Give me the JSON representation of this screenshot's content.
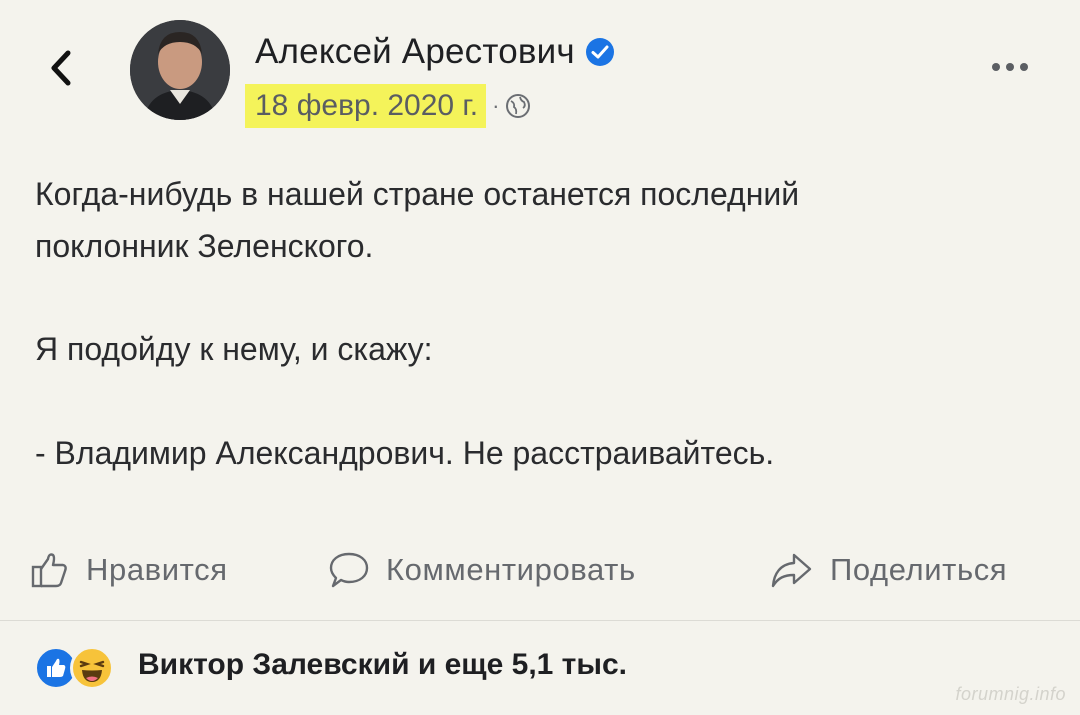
{
  "header": {
    "author_name": "Алексей Арестович",
    "post_date": "18 февр. 2020 г.",
    "separator": "·",
    "icons": {
      "back": "chevron-left-icon",
      "verified": "verified-badge-icon",
      "audience": "globe-icon",
      "more": "more-options-icon"
    },
    "colors": {
      "date_highlight": "#f4f35a",
      "verified": "#1b74e4"
    }
  },
  "post": {
    "paragraphs": [
      "Когда-нибудь в нашей стране останется последний",
      "поклонник Зеленского.",
      "Я подойду к нему, и скажу:",
      "- Владимир Александрович. Не расстраивайтесь."
    ]
  },
  "actions": {
    "like_label": "Нравится",
    "comment_label": "Комментировать",
    "share_label": "Поделиться",
    "icons": [
      "thumbs-up-icon",
      "comment-bubble-icon",
      "share-arrow-icon"
    ]
  },
  "reactions": {
    "summary": "Виктор Залевский и еще 5,1 тыс.",
    "icons": [
      "like-reaction-icon",
      "haha-reaction-icon"
    ]
  },
  "watermark": "forumnig.info"
}
